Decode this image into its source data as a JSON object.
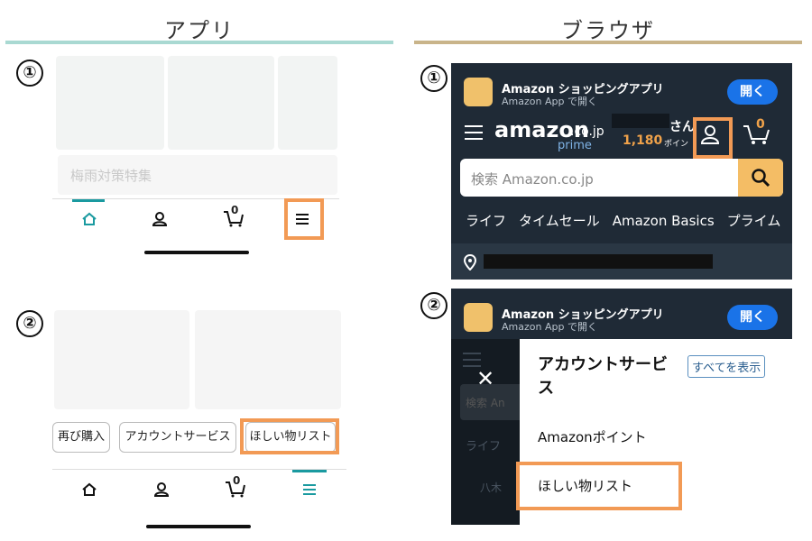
{
  "headers": {
    "app": "アプリ",
    "browser": "ブラウザ"
  },
  "steps": {
    "one": "①",
    "two": "②"
  },
  "colors": {
    "highlight": "#f29a55",
    "app_rule": "#a9d9d2",
    "browser_rule": "#c9b48a",
    "amazon_dark": "#1f2a36",
    "teal": "#1a9aa0"
  },
  "app": {
    "faded_banner": "梅雨対策特集",
    "nav_icons": [
      "home-icon",
      "account-icon",
      "cart-icon",
      "menu-icon"
    ],
    "cart_count": "0",
    "chips": [
      "再び購入",
      "アカウントサービス",
      "ほしい物リスト"
    ]
  },
  "browser": {
    "banner_title": "Amazon ショッピングアプリ",
    "banner_sub": "Amazon App で開く",
    "open_label": "開く",
    "logo_text": "amazon",
    "logo_domain": ".co.jp",
    "logo_prime": "prime",
    "greeting": "さん",
    "points": "1,180",
    "points_label": "ポイン",
    "cart_count": "0",
    "search_placeholder": "検索 Amazon.co.jp",
    "nav_links": [
      "ライフ",
      "タイムセール",
      "Amazon Basics",
      "プライム"
    ],
    "menu": {
      "title": "アカウントサービス",
      "show_all": "すべてを表示",
      "items": [
        "Amazonポイント",
        "ほしい物リスト"
      ],
      "close": "✕"
    },
    "behind": {
      "search_fragment": "検索 An",
      "link_fragment": "ライフ",
      "location_fragment": "八木"
    }
  }
}
